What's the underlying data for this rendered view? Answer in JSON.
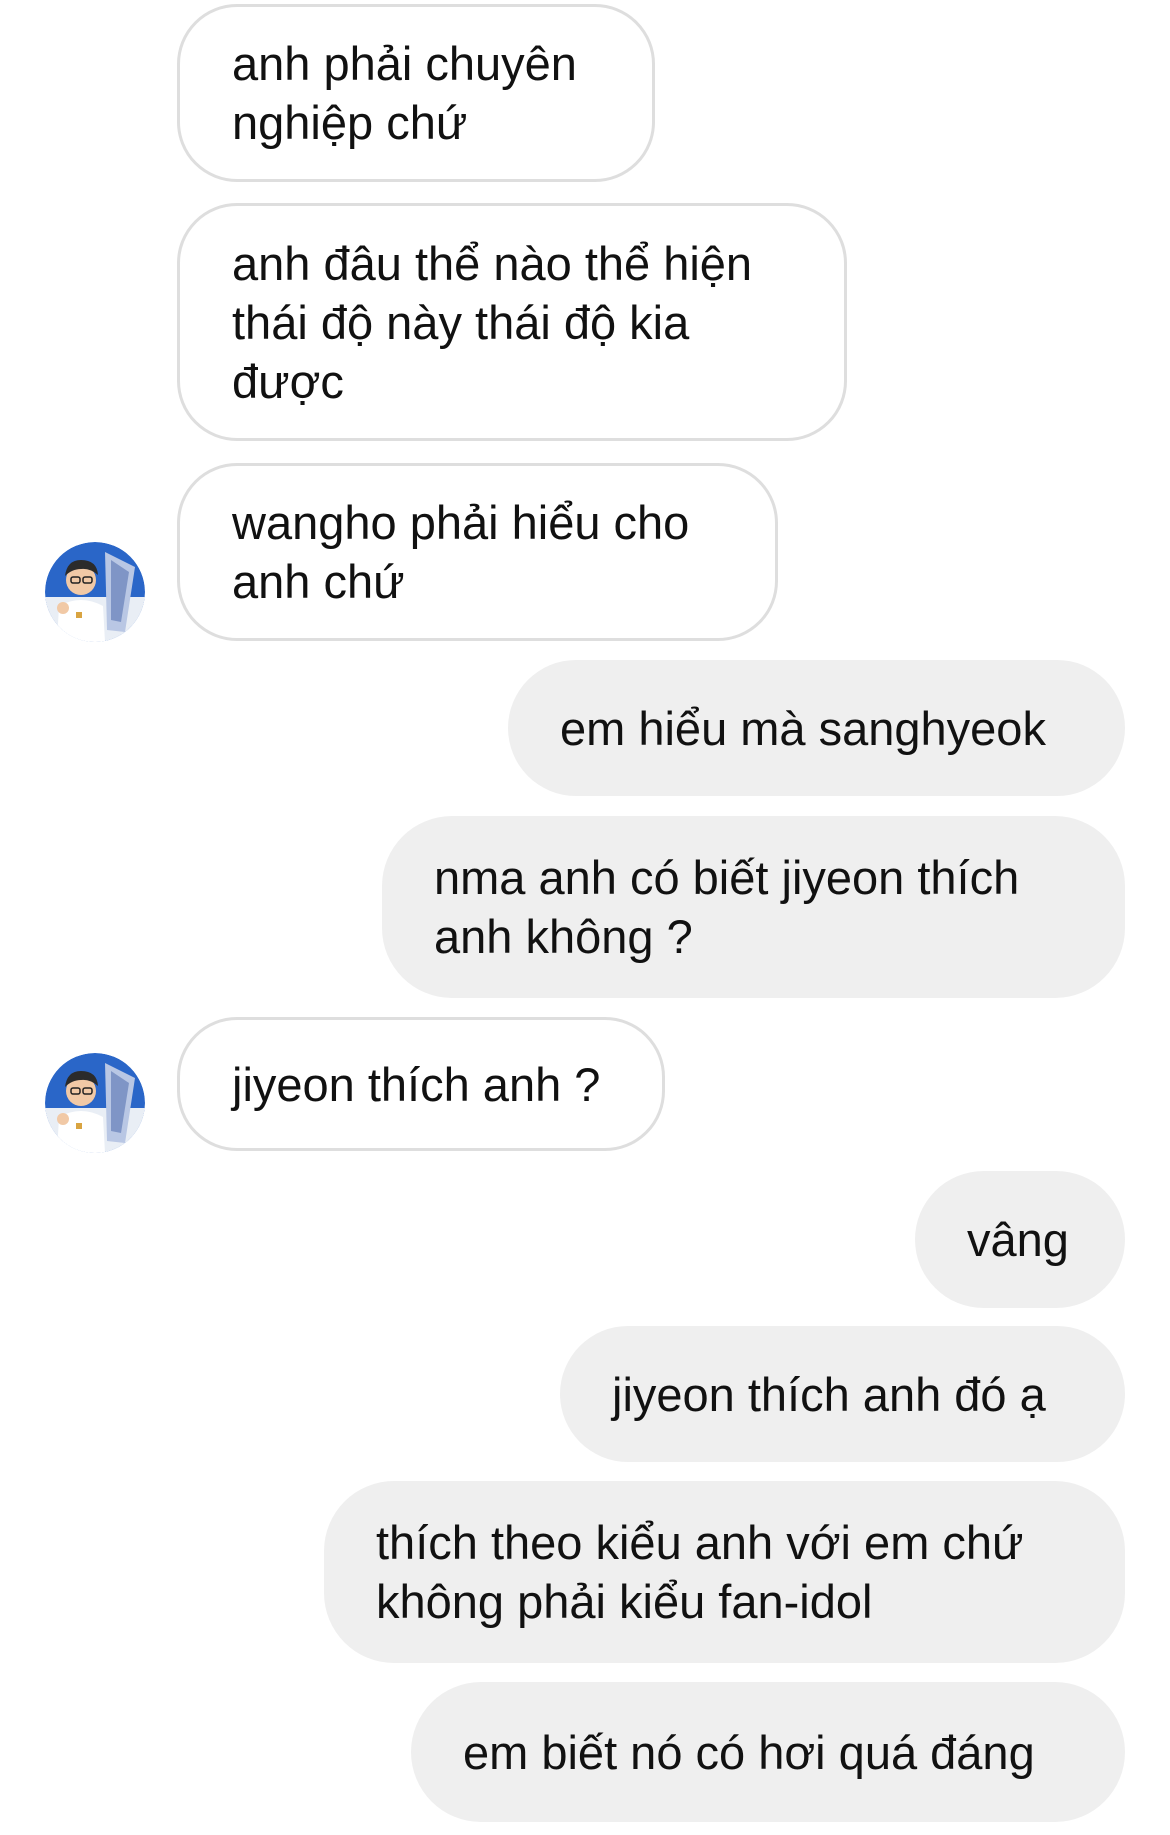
{
  "conversation": {
    "messages": [
      {
        "side": "incoming",
        "text": "anh phải chuyên\nnghiệp chứ"
      },
      {
        "side": "incoming",
        "text": "anh đâu thể nào thể hiện\nthái độ này thái độ kia\nđược"
      },
      {
        "side": "incoming",
        "text": "wangho phải hiểu cho\nanh chứ"
      },
      {
        "side": "outgoing",
        "text": "em hiểu mà sanghyeok"
      },
      {
        "side": "outgoing",
        "text": "nma anh có biết jiyeon thích\nanh không ?"
      },
      {
        "side": "incoming",
        "text": "jiyeon thích anh ?"
      },
      {
        "side": "outgoing",
        "text": "vâng"
      },
      {
        "side": "outgoing",
        "text": "jiyeon thích anh đó ạ"
      },
      {
        "side": "outgoing",
        "text": "thích theo kiểu anh với em chứ\nkhông phải kiểu fan-idol"
      },
      {
        "side": "outgoing",
        "text": "em biết nó có hơi quá đáng"
      }
    ],
    "avatar_icon": "profile-photo-avatar-icon",
    "colors": {
      "incoming_bubble_bg": "#ffffff",
      "incoming_bubble_border": "#dedede",
      "outgoing_bubble_bg": "#efefef",
      "text": "#111111"
    }
  }
}
